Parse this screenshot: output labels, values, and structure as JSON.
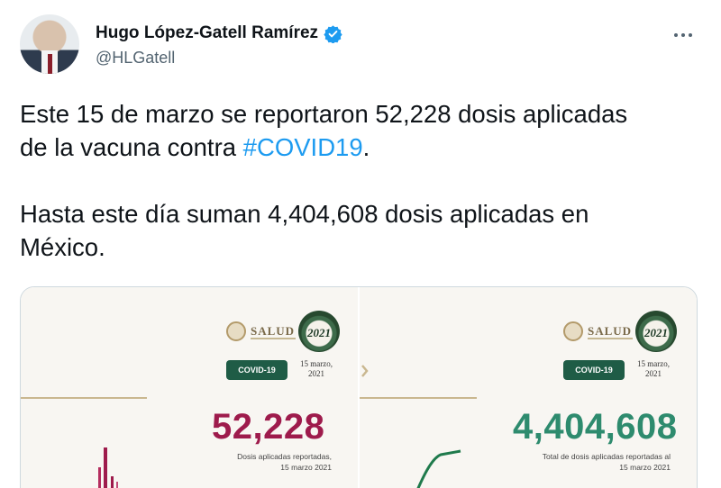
{
  "author": {
    "display_name": "Hugo López-Gatell Ramírez",
    "handle": "@HLGatell",
    "verified": true
  },
  "tweet": {
    "line1": "Este 15 de marzo se reportaron 52,228 dosis aplicadas",
    "line2_prefix": "de la vacuna contra ",
    "hashtag": "#COVID19",
    "line2_suffix": ".",
    "line3": "Hasta este día suman 4,404,608 dosis aplicadas en",
    "line4": "México."
  },
  "media": {
    "left": {
      "brand": "SALUD",
      "logo_year": "2021",
      "badge": "COVID-19",
      "date_line1": "15 marzo,",
      "date_line2": "2021",
      "value": "52,228",
      "caption_line1": "Dosis aplicadas reportadas,",
      "caption_line2": "15 marzo 2021",
      "value_color": "#9e1b4c"
    },
    "right": {
      "brand": "SALUD",
      "logo_year": "2021",
      "badge": "COVID-19",
      "date_line1": "15 marzo,",
      "date_line2": "2021",
      "value": "4,404,608",
      "caption_line1": "Total de dosis aplicadas reportadas al",
      "caption_line2": "15 marzo 2021",
      "value_color": "#2e8b6e"
    }
  },
  "colors": {
    "hashtag": "#1d9bf0",
    "badge": "#1f5c46",
    "verified": "#1d9bf0"
  },
  "icons": {
    "verified": "verified-badge-icon",
    "more": "more-horizontal-icon"
  }
}
